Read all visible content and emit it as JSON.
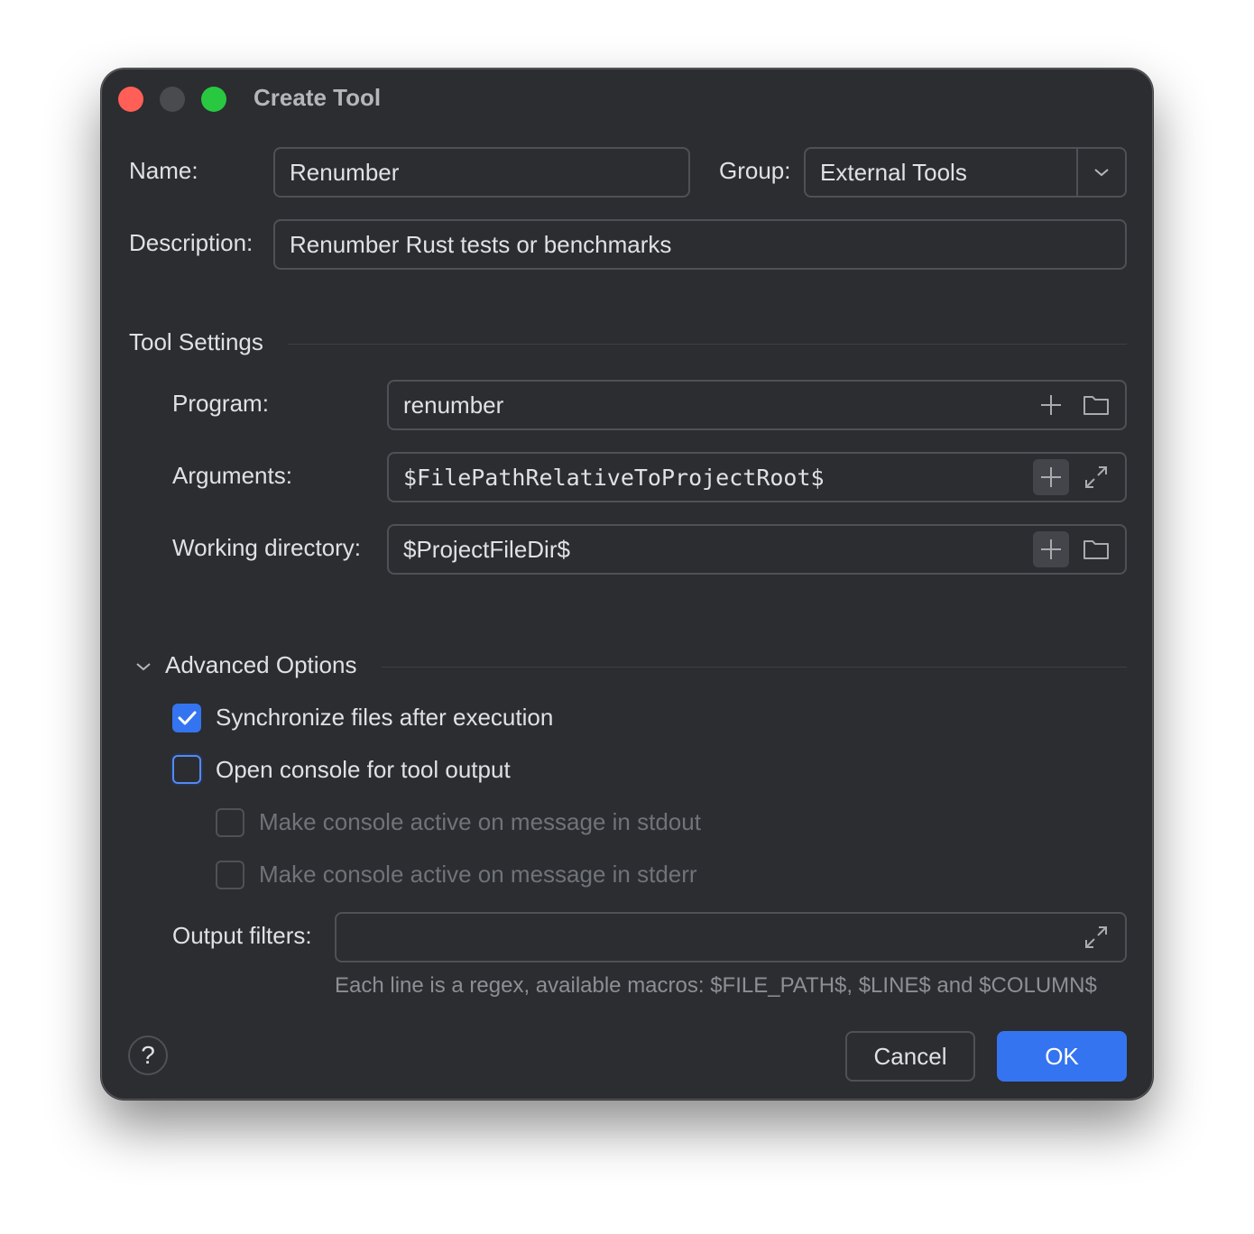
{
  "window": {
    "title": "Create Tool"
  },
  "name": {
    "label": "Name:",
    "value": "Renumber"
  },
  "group": {
    "label": "Group:",
    "value": "External Tools"
  },
  "description": {
    "label": "Description:",
    "value": "Renumber Rust tests or benchmarks"
  },
  "tool_settings": {
    "heading": "Tool Settings",
    "program": {
      "label": "Program:",
      "value": "renumber"
    },
    "arguments": {
      "label": "Arguments:",
      "value": "$FilePathRelativeToProjectRoot$"
    },
    "working_dir": {
      "label": "Working directory:",
      "value": "$ProjectFileDir$"
    }
  },
  "advanced": {
    "heading": "Advanced Options",
    "sync_files": {
      "label": "Synchronize files after execution",
      "checked": true
    },
    "open_console": {
      "label": "Open console for tool output",
      "checked": false
    },
    "stdout_active": {
      "label": "Make console active on message in stdout",
      "checked": false,
      "enabled": false
    },
    "stderr_active": {
      "label": "Make console active on message in stderr",
      "checked": false,
      "enabled": false
    },
    "output_filters": {
      "label": "Output filters:",
      "value": ""
    },
    "hint": "Each line is a regex, available macros: $FILE_PATH$, $LINE$ and $COLUMN$"
  },
  "buttons": {
    "help": "?",
    "cancel": "Cancel",
    "ok": "OK"
  },
  "colors": {
    "accent": "#3574f0",
    "background": "#2b2d30",
    "close": "#ff5f57",
    "maximize": "#28c840"
  }
}
